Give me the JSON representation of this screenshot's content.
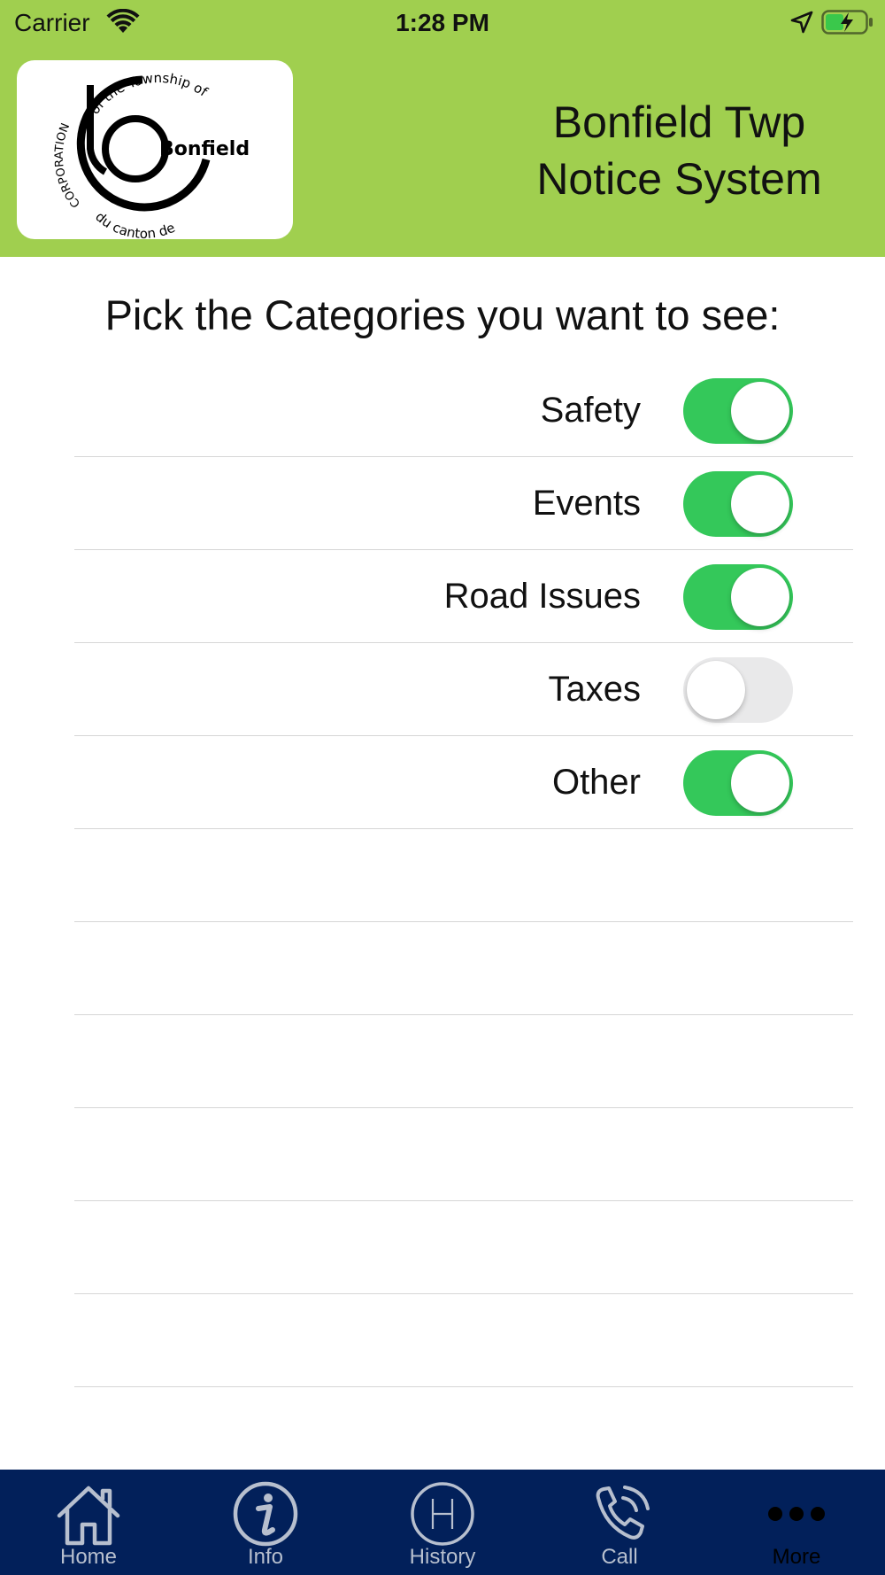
{
  "status_bar": {
    "carrier": "Carrier",
    "time": "1:28 PM",
    "wifi_icon": "wifi-icon",
    "location_icon": "location-arrow-icon",
    "battery_icon": "battery-charging-icon"
  },
  "header": {
    "background_color": "#a0cf4f",
    "logo": {
      "arc_top_text": "of the Township of",
      "arc_left_text": "CORPORATION",
      "arc_bottom_text": "du canton de",
      "name_text": "Bonfield"
    },
    "title_line1": "Bonfield Twp",
    "title_line2": "Notice System"
  },
  "main": {
    "prompt": "Pick the Categories you want to see:",
    "categories": [
      {
        "label": "Safety",
        "enabled": true
      },
      {
        "label": "Events",
        "enabled": true
      },
      {
        "label": "Road Issues",
        "enabled": true
      },
      {
        "label": "Taxes",
        "enabled": false
      },
      {
        "label": "Other",
        "enabled": true
      }
    ],
    "toggle_on_color": "#34c85a",
    "toggle_off_color": "#e9e9ea"
  },
  "tab_bar": {
    "background_color": "#02205a",
    "tabs": [
      {
        "label": "Home",
        "icon": "home-icon",
        "active": false
      },
      {
        "label": "Info",
        "icon": "info-icon",
        "active": false
      },
      {
        "label": "History",
        "icon": "history-h-icon",
        "active": false
      },
      {
        "label": "Call",
        "icon": "phone-icon",
        "active": false
      },
      {
        "label": "More",
        "icon": "more-dots-icon",
        "active": true
      }
    ]
  }
}
